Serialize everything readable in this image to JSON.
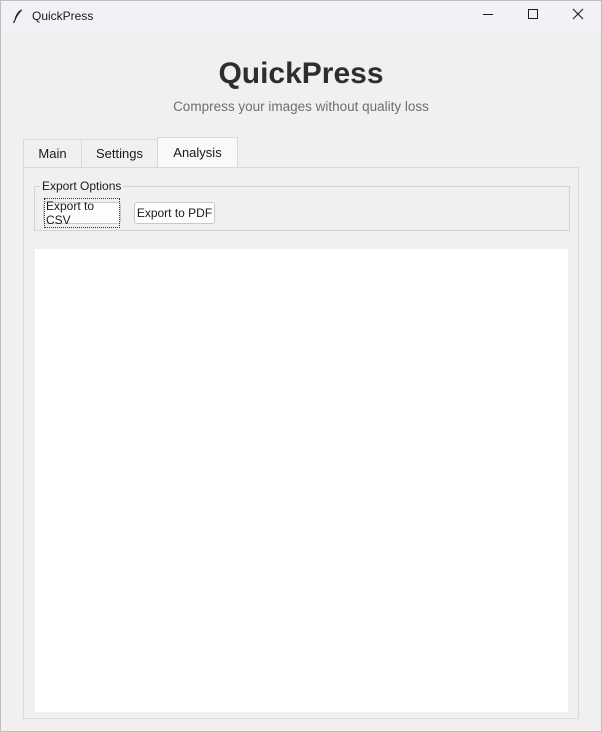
{
  "window": {
    "title": "QuickPress",
    "icon": "feather-icon",
    "controls": [
      "minimize-icon",
      "maximize-icon",
      "close-icon"
    ]
  },
  "header": {
    "title": "QuickPress",
    "subtitle": "Compress your images without quality loss"
  },
  "tabs": [
    {
      "label": "Main",
      "selected": false
    },
    {
      "label": "Settings",
      "selected": false
    },
    {
      "label": "Analysis",
      "selected": true
    }
  ],
  "analysis": {
    "export_group_label": "Export Options",
    "export_csv_label": "Export to CSV",
    "export_pdf_label": "Export to PDF"
  },
  "colors": {
    "window_bg": "#f0f0f0",
    "titlebar_bg": "#f3f0f7",
    "content_bg": "#ffffff",
    "title_text": "#2e2e2e",
    "subtitle_text": "#6e6e6e"
  }
}
